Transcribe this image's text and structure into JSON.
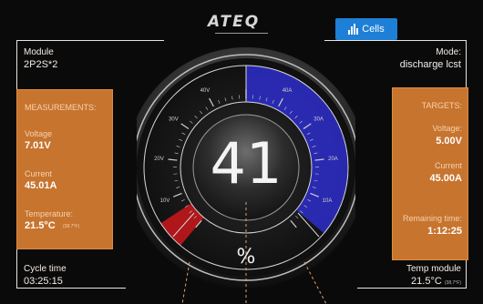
{
  "header": {
    "logo": "ATEQ",
    "cells_button": "Cells"
  },
  "left": {
    "module_label": "Module",
    "module_value": "2P2S*2",
    "panel": {
      "title": "MEASUREMENTS:",
      "voltage_label": "Voltage",
      "voltage_value": "7.01V",
      "current_label": "Current",
      "current_value": "45.01A",
      "temperature_label": "Temperature:",
      "temperature_value": "21.5°C",
      "temperature_note": "(38.7°F)"
    },
    "cycle_label": "Cycle time",
    "cycle_value": "03:25:15"
  },
  "right": {
    "mode_label": "Mode:",
    "mode_value": "discharge lcst",
    "panel": {
      "title": "TARGETS:",
      "voltage_label": "Voltage:",
      "voltage_value": "5.00V",
      "current_label": "Current",
      "current_value": "45.00A",
      "remaining_label": "Remaining time:",
      "remaining_value": "1:12:25"
    },
    "temp_label": "Temp module",
    "temp_value": "21.5°C",
    "temp_note": "(38.7°F)"
  },
  "gauge": {
    "value": "41",
    "unit": "%",
    "left_ticks": [
      "10V",
      "20V",
      "30V",
      "40V"
    ],
    "right_ticks": [
      "10A",
      "20A",
      "30A",
      "40A"
    ],
    "left_level": 0.12,
    "right_level": 0.93,
    "colors": {
      "left_fill": "#c0171c",
      "right_fill": "#2c2cc2",
      "panel": "#c7742f"
    }
  }
}
